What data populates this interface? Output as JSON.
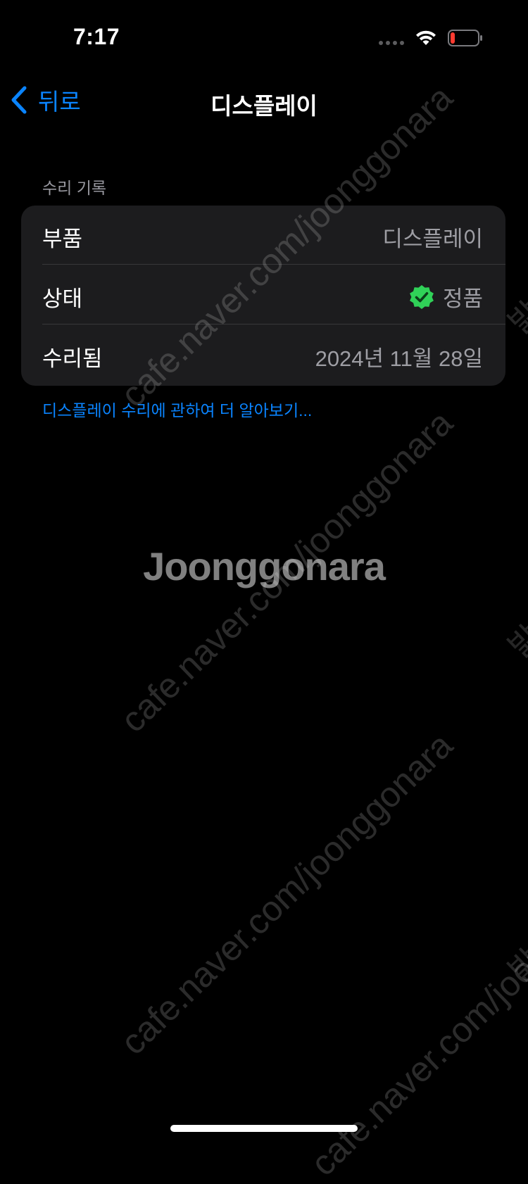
{
  "status_bar": {
    "time": "7:17",
    "colors": {
      "battery_low": "#ff3b30",
      "signal_inactive": "#5c5c5e"
    }
  },
  "nav": {
    "back_label": "뒤로",
    "title": "디스플레이",
    "accent": "#0a84ff"
  },
  "section": {
    "header": "수리 기록",
    "rows": [
      {
        "label": "부품",
        "value": "디스플레이"
      },
      {
        "label": "상태",
        "value": "정품",
        "badge_icon": "verified-check-icon",
        "badge_color": "#30d158"
      },
      {
        "label": "수리됨",
        "value": "2024년 11월 28일"
      }
    ]
  },
  "learn_more": "디스플레이 수리에 관하여 더 알아보기...",
  "watermark": {
    "url": "cafe.naver.com/joonggonara",
    "logo": "Joonggonara",
    "side": "밝은"
  }
}
